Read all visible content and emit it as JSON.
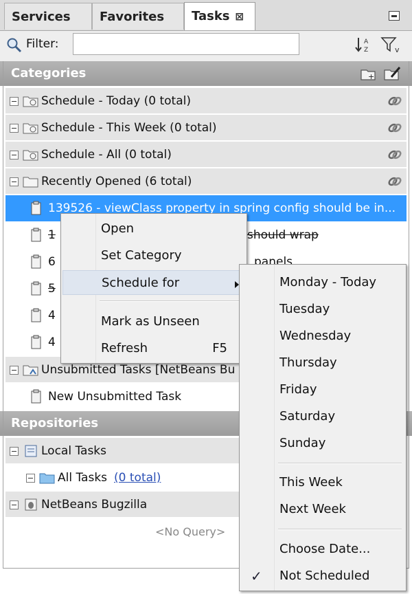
{
  "tabs": [
    {
      "label": "Services"
    },
    {
      "label": "Favorites"
    },
    {
      "label": "Tasks",
      "close": "⊠"
    }
  ],
  "filter": {
    "label": "Filter:",
    "value": ""
  },
  "categories": {
    "header": "Categories",
    "rows": [
      {
        "label": "Schedule - Today  (0 total)"
      },
      {
        "label": "Schedule - This Week  (0 total)"
      },
      {
        "label": "Schedule - All  (0 total)"
      },
      {
        "label": "Recently Opened  (6 total)"
      }
    ],
    "tasks": [
      {
        "label": "139526 - viewClass property in spring config should be in..."
      },
      {
        "label": "1"
      },
      {
        "label": "6"
      },
      {
        "label": "5"
      },
      {
        "label": "4"
      },
      {
        "label": "4"
      }
    ],
    "task_fragments": {
      "row2": "should wrap",
      "row3": "panels"
    },
    "unsubmitted": {
      "label": "Unsubmitted Tasks [NetBeans Bu"
    },
    "new_task": {
      "label": "New Unsubmitted Task"
    }
  },
  "repositories": {
    "header": "Repositories",
    "local": {
      "label": "Local Tasks"
    },
    "all_tasks": {
      "label": "All Tasks",
      "count": "(0 total)"
    },
    "bugzilla": {
      "label": "NetBeans Bugzilla"
    },
    "no_query": "<No Query>"
  },
  "context_menu": {
    "items": [
      {
        "label": "Open"
      },
      {
        "label": "Set Category"
      },
      {
        "label": "Schedule for"
      },
      {
        "label": "Mark as Unseen"
      },
      {
        "label": "Refresh",
        "accel": "F5"
      }
    ]
  },
  "submenu": {
    "days": [
      "Monday - Today",
      "Tuesday",
      "Wednesday",
      "Thursday",
      "Friday",
      "Saturday",
      "Sunday"
    ],
    "weeks": [
      "This Week",
      "Next Week"
    ],
    "other": [
      "Choose Date...",
      "Not Scheduled"
    ],
    "checked": "✓"
  },
  "colors": {
    "selection": "#3399ff",
    "header": "#a6a6a6"
  }
}
